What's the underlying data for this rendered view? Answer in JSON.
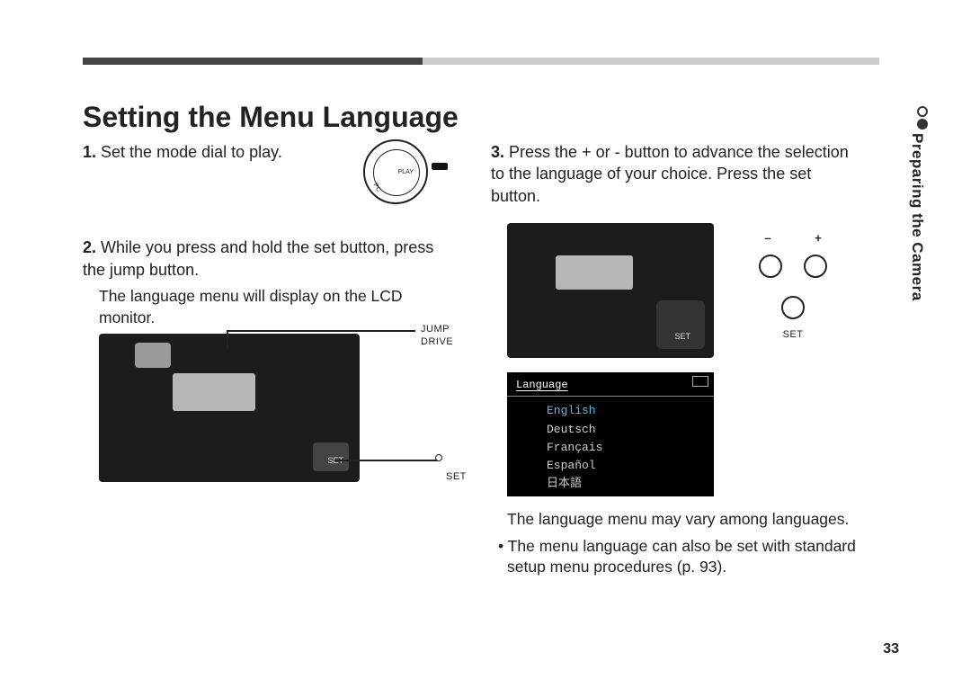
{
  "header": {
    "title": "Setting the Menu Language",
    "section_tab": "Preparing the Camera"
  },
  "left": {
    "step1": {
      "num": "1.",
      "text": "Set the mode dial to play."
    },
    "dial": {
      "label_play": "PLAY",
      "label_pc": "PC"
    },
    "step2": {
      "num": "2.",
      "text": "While you press and hold the set button, press the jump button."
    },
    "step2_caption": "The language menu will display on the LCD monitor.",
    "ill1_labels": {
      "jump": "JUMP",
      "drive": "DRIVE",
      "set": "SET"
    }
  },
  "right": {
    "step3": {
      "num": "3.",
      "text": "Press the + or - button to advance the selection to the language of your choice. Press the set button."
    },
    "btns": {
      "minus": "–",
      "plus": "+",
      "set": "SET"
    },
    "lcd": {
      "title": "Language",
      "items": [
        "English",
        "Deutsch",
        "Français",
        "Español",
        "日本語"
      ],
      "selected_index": 0
    },
    "caption_after": "The language menu may vary among languages.",
    "bullet_1": "• The menu language can also be set with standard setup menu procedures (p. 93)."
  },
  "page_number": "33"
}
